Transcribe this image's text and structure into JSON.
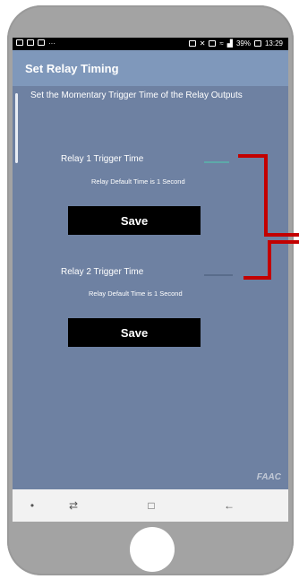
{
  "status_bar": {
    "battery": "39%",
    "time": "13:29",
    "left_icons": [
      "gallery-icon",
      "n-icon",
      "image-icon",
      "more-icon"
    ],
    "right_icons": [
      "save-icon",
      "mute-icon",
      "alarm-icon",
      "wifi-icon",
      "signal-icon",
      "battery-icon"
    ],
    "more": "···"
  },
  "app": {
    "title": "Set Relay Timing",
    "subtitle": "Set the Momentary Trigger Time of the Relay Outputs"
  },
  "relays": [
    {
      "label": "Relay 1 Trigger Time",
      "hint": "Relay Default Time is 1 Second",
      "save_label": "Save"
    },
    {
      "label": "Relay 2 Trigger Time",
      "hint": "Relay Default Time is 1 Second",
      "save_label": "Save"
    }
  ],
  "brand": {
    "name": "FAAC"
  },
  "nav": {
    "items": [
      "dot-icon",
      "recent-apps-icon",
      "home-square-icon",
      "back-arrow-icon"
    ]
  },
  "colors": {
    "screen_bg": "#6e81a2",
    "titlebar_bg": "#7f98bb",
    "button_bg": "#000000",
    "callout_red": "#c30000",
    "field_underline_active": "#5da9a9"
  }
}
